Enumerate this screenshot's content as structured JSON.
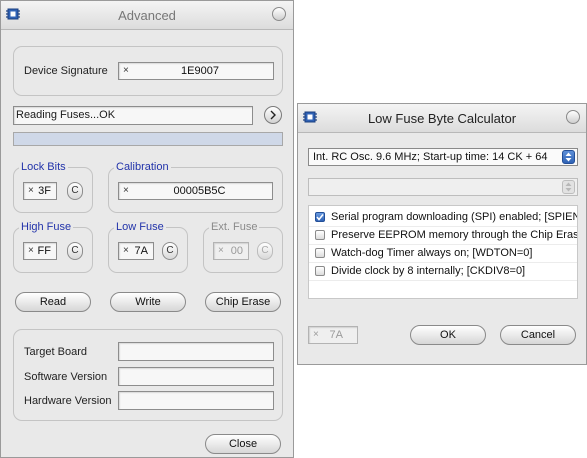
{
  "advanced": {
    "title": "Advanced",
    "device_signature": {
      "label": "Device Signature",
      "value": "1E9007"
    },
    "status_text": "Reading Fuses...OK",
    "progress_fraction": 1.0,
    "lock_bits": {
      "label": "Lock Bits",
      "value": "3F",
      "calc_label": "C"
    },
    "calibration": {
      "label": "Calibration",
      "value": "00005B5C"
    },
    "high_fuse": {
      "label": "High Fuse",
      "value": "FF",
      "calc_label": "C"
    },
    "low_fuse": {
      "label": "Low Fuse",
      "value": "7A",
      "calc_label": "C"
    },
    "ext_fuse": {
      "label": "Ext. Fuse",
      "value": "00",
      "calc_label": "C"
    },
    "buttons": {
      "read": "Read",
      "write": "Write",
      "chip_erase": "Chip Erase",
      "close": "Close"
    },
    "info": {
      "target_board": "Target Board",
      "software_version": "Software Version",
      "hardware_version": "Hardware Version"
    }
  },
  "calculator": {
    "title": "Low Fuse Byte Calculator",
    "clock_select": "Int. RC Osc. 9.6 MHz; Start-up time: 14 CK + 64",
    "second_select": "",
    "options": [
      {
        "label": "Serial program downloading (SPI) enabled; [SPIEN=",
        "checked": true
      },
      {
        "label": "Preserve EEPROM memory through the Chip Erase",
        "checked": false
      },
      {
        "label": "Watch-dog Timer always on; [WDTON=0]",
        "checked": false
      },
      {
        "label": "Divide clock by 8 internally; [CKDIV8=0]",
        "checked": false
      }
    ],
    "value": "7A",
    "buttons": {
      "ok": "OK",
      "cancel": "Cancel"
    }
  },
  "colors": {
    "group_legend": "#2233aa",
    "check_accent": "#2f62b5"
  },
  "icons": {
    "app": "chip-app-icon",
    "arrow": "arrow-right-icon",
    "close": "window-close-icon"
  }
}
